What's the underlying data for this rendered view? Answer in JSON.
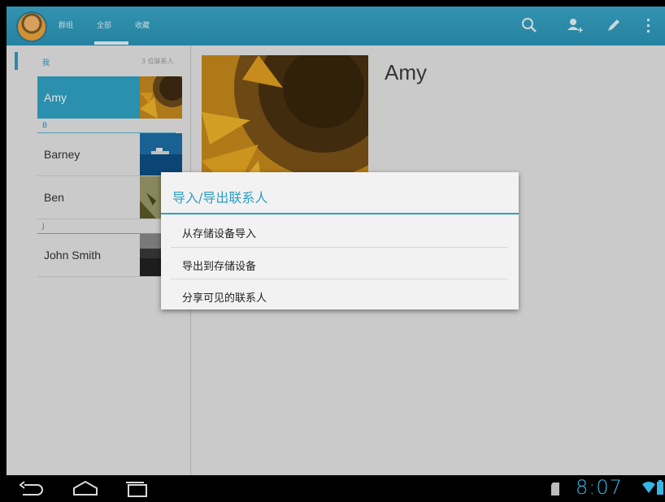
{
  "action_bar": {
    "tabs": [
      "群组",
      "全部",
      "收藏"
    ],
    "active_tab_index": 1,
    "icons": [
      "search-icon",
      "add-contact-icon",
      "edit-icon",
      "overflow-menu-icon"
    ]
  },
  "contact_list": {
    "sections": [
      {
        "header": "我",
        "count_label": "3 位联系人",
        "contacts": [
          {
            "name": "Amy",
            "selected": true
          }
        ]
      },
      {
        "header": "B",
        "contacts": [
          {
            "name": "Barney"
          },
          {
            "name": "Ben"
          }
        ]
      },
      {
        "header": "J",
        "contacts": [
          {
            "name": "John Smith"
          }
        ]
      }
    ]
  },
  "detail": {
    "name": "Amy"
  },
  "dialog": {
    "title": "导入/导出联系人",
    "items": [
      "从存储设备导入",
      "导出到存储设备",
      "分享可见的联系人"
    ]
  },
  "status_bar": {
    "time": "8:07"
  },
  "colors": {
    "accent": "#2f9ec4",
    "action_bar": "#3aa7c9",
    "clock": "#37b6e6"
  }
}
